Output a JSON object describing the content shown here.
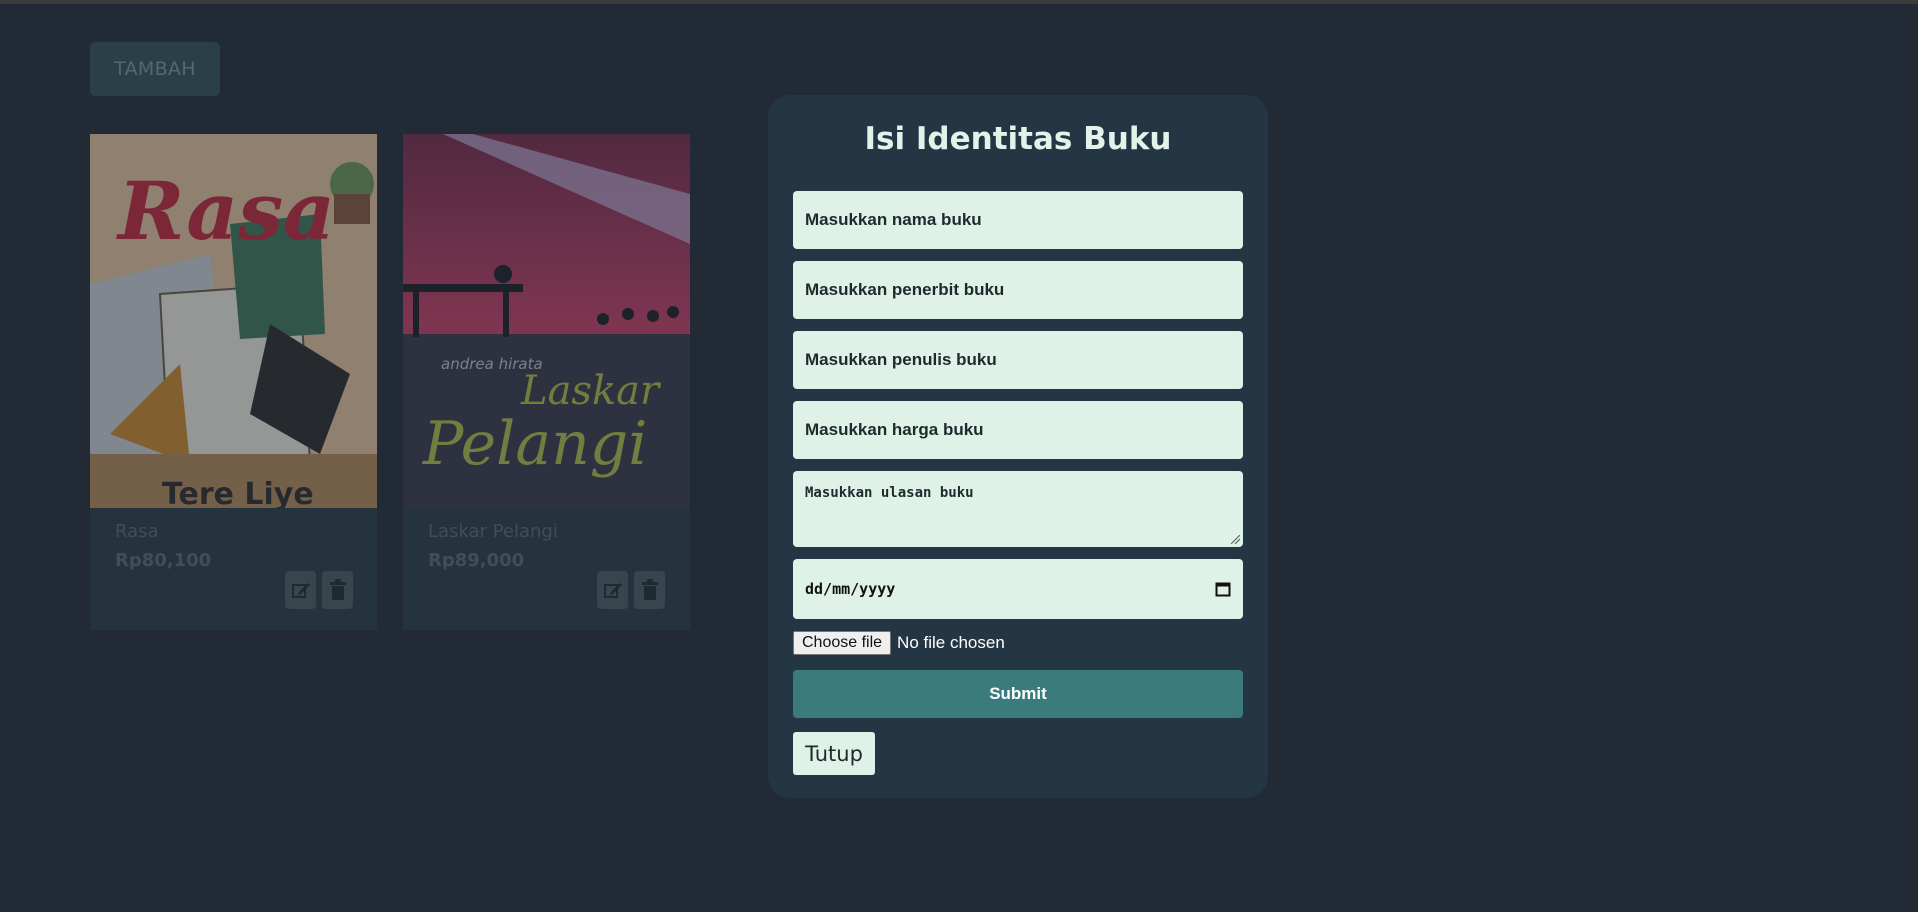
{
  "toolbar": {
    "add_label": "TAMBAH"
  },
  "books": [
    {
      "title": "Rasa",
      "price": "Rp80,100",
      "cover_title": "Rasa",
      "cover_author": "Tere Liye"
    },
    {
      "title": "Laskar Pelangi",
      "price": "Rp89,000",
      "cover_title_1": "Laskar",
      "cover_title_2": "Pelangi",
      "cover_author": "andrea hirata"
    }
  ],
  "modal": {
    "title": "Isi Identitas Buku",
    "name_placeholder": "Masukkan nama buku",
    "publisher_placeholder": "Masukkan penerbit buku",
    "writer_placeholder": "Masukkan penulis buku",
    "price_placeholder": "Masukkan harga buku",
    "review_placeholder": "Masukkan ulasan buku",
    "date_placeholder": "dd/mm/yyyy",
    "file_button": "Choose file",
    "file_status": "No file chosen",
    "submit_label": "Submit",
    "close_label": "Tutup"
  },
  "colors": {
    "background": "#222b35",
    "modal_bg": "#243644",
    "field_bg": "#dff2e7",
    "submit_bg": "#3b7a7d"
  },
  "icons": [
    "edit-icon",
    "trash-icon",
    "calendar-icon"
  ]
}
